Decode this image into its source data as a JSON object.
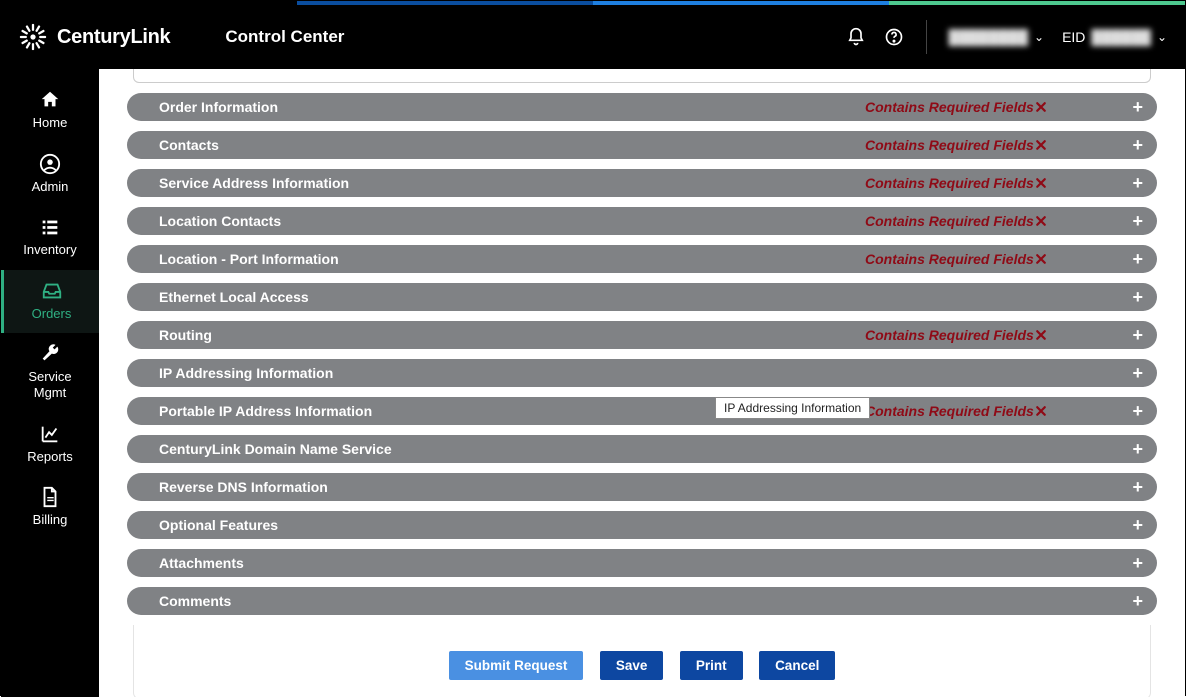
{
  "header": {
    "brand": "CenturyLink",
    "app": "Control Center",
    "eid_label": "EID",
    "user_blur1": "——",
    "user_blur2": "——"
  },
  "sidebar": {
    "items": [
      {
        "label": "Home",
        "icon": "home-icon"
      },
      {
        "label": "Admin",
        "icon": "user-circle-icon"
      },
      {
        "label": "Inventory",
        "icon": "list-icon"
      },
      {
        "label": "Orders",
        "icon": "inbox-icon",
        "active": true
      },
      {
        "label": "Service Mgmt",
        "icon": "wrench-icon"
      },
      {
        "label": "Reports",
        "icon": "chart-icon"
      },
      {
        "label": "Billing",
        "icon": "document-icon"
      }
    ]
  },
  "required_text": "Contains Required Fields",
  "sections": [
    {
      "title": "Order Information",
      "required": true
    },
    {
      "title": "Contacts",
      "required": true
    },
    {
      "title": "Service Address Information",
      "required": true
    },
    {
      "title": "Location Contacts",
      "required": true
    },
    {
      "title": "Location - Port Information",
      "required": true
    },
    {
      "title": "Ethernet Local Access",
      "required": false
    },
    {
      "title": "Routing",
      "required": true
    },
    {
      "title": "IP Addressing Information",
      "required": false
    },
    {
      "title": "Portable IP Address Information",
      "required": true
    },
    {
      "title": "CenturyLink Domain Name Service",
      "required": false
    },
    {
      "title": "Reverse DNS Information",
      "required": false
    },
    {
      "title": "Optional Features",
      "required": false
    },
    {
      "title": "Attachments",
      "required": false
    },
    {
      "title": "Comments",
      "required": false
    }
  ],
  "tooltip": "IP Addressing Information",
  "buttons": {
    "submit": "Submit Request",
    "save": "Save",
    "print": "Print",
    "cancel": "Cancel"
  }
}
